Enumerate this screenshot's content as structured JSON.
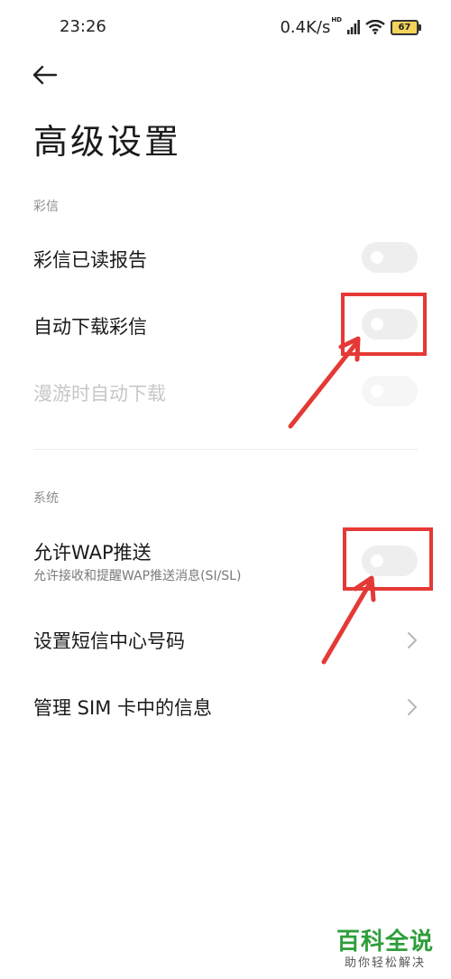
{
  "status_bar": {
    "time": "23:26",
    "net_speed": "0.4K/s",
    "hd": "HD",
    "battery": "67"
  },
  "page": {
    "title": "高级设置"
  },
  "sections": {
    "mms": {
      "header": "彩信",
      "read_report": {
        "label": "彩信已读报告",
        "enabled": false
      },
      "auto_download": {
        "label": "自动下载彩信",
        "enabled": false
      },
      "roaming_download": {
        "label": "漫游时自动下载",
        "enabled": false,
        "disabled": true
      }
    },
    "system": {
      "header": "系统",
      "wap_push": {
        "label": "允许WAP推送",
        "subtitle": "允许接收和提醒WAP推送消息(SI/SL)",
        "enabled": false
      },
      "smsc": {
        "label": "设置短信中心号码"
      },
      "sim_messages": {
        "label": "管理 SIM 卡中的信息"
      }
    }
  },
  "watermark": {
    "logo_text": "百科全说",
    "tagline": "助你轻松解决"
  },
  "colors": {
    "annotation": "#e53935",
    "toggle_off": "#eeeeee",
    "watermark_green": "#2e9e3a"
  }
}
